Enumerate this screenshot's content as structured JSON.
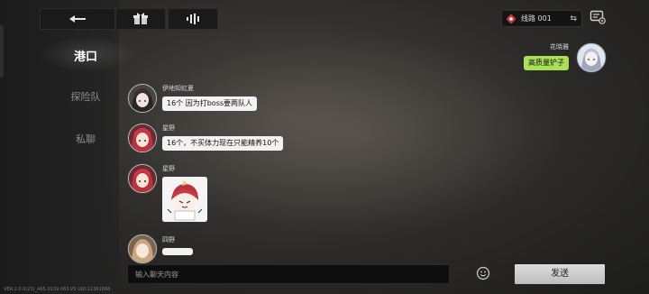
{
  "sidebar": {
    "items": [
      {
        "label": "港口",
        "active": true
      },
      {
        "label": "探险队",
        "active": false
      },
      {
        "label": "私聊",
        "active": false
      }
    ]
  },
  "toolbar": {
    "buttons": [
      {
        "icon": "back-arrow-icon"
      },
      {
        "icon": "gift-icon"
      },
      {
        "icon": "voice-wave-icon"
      }
    ]
  },
  "line_selector": {
    "label": "线路 001",
    "swap_glyph": "⇆"
  },
  "messages": [
    {
      "side": "right",
      "name": "花晓雅",
      "text": "高质量铲子",
      "bubble_color": "#a8e05a"
    },
    {
      "side": "left",
      "name": "伊地知虹夏",
      "text": "16个 因为打boss要两队人"
    },
    {
      "side": "left",
      "name": "星野",
      "text": "16个，不买体力现在只能精养10个"
    },
    {
      "side": "left",
      "name": "星野",
      "sticker": "chibi-sticker"
    },
    {
      "side": "left",
      "name": "四野",
      "text": ""
    }
  ],
  "composer": {
    "placeholder": "输入聊天内容",
    "send_label": "发送"
  },
  "version_text": "VER:2.0.0(23)_A65.0139.063.V5   UID:11361868"
}
